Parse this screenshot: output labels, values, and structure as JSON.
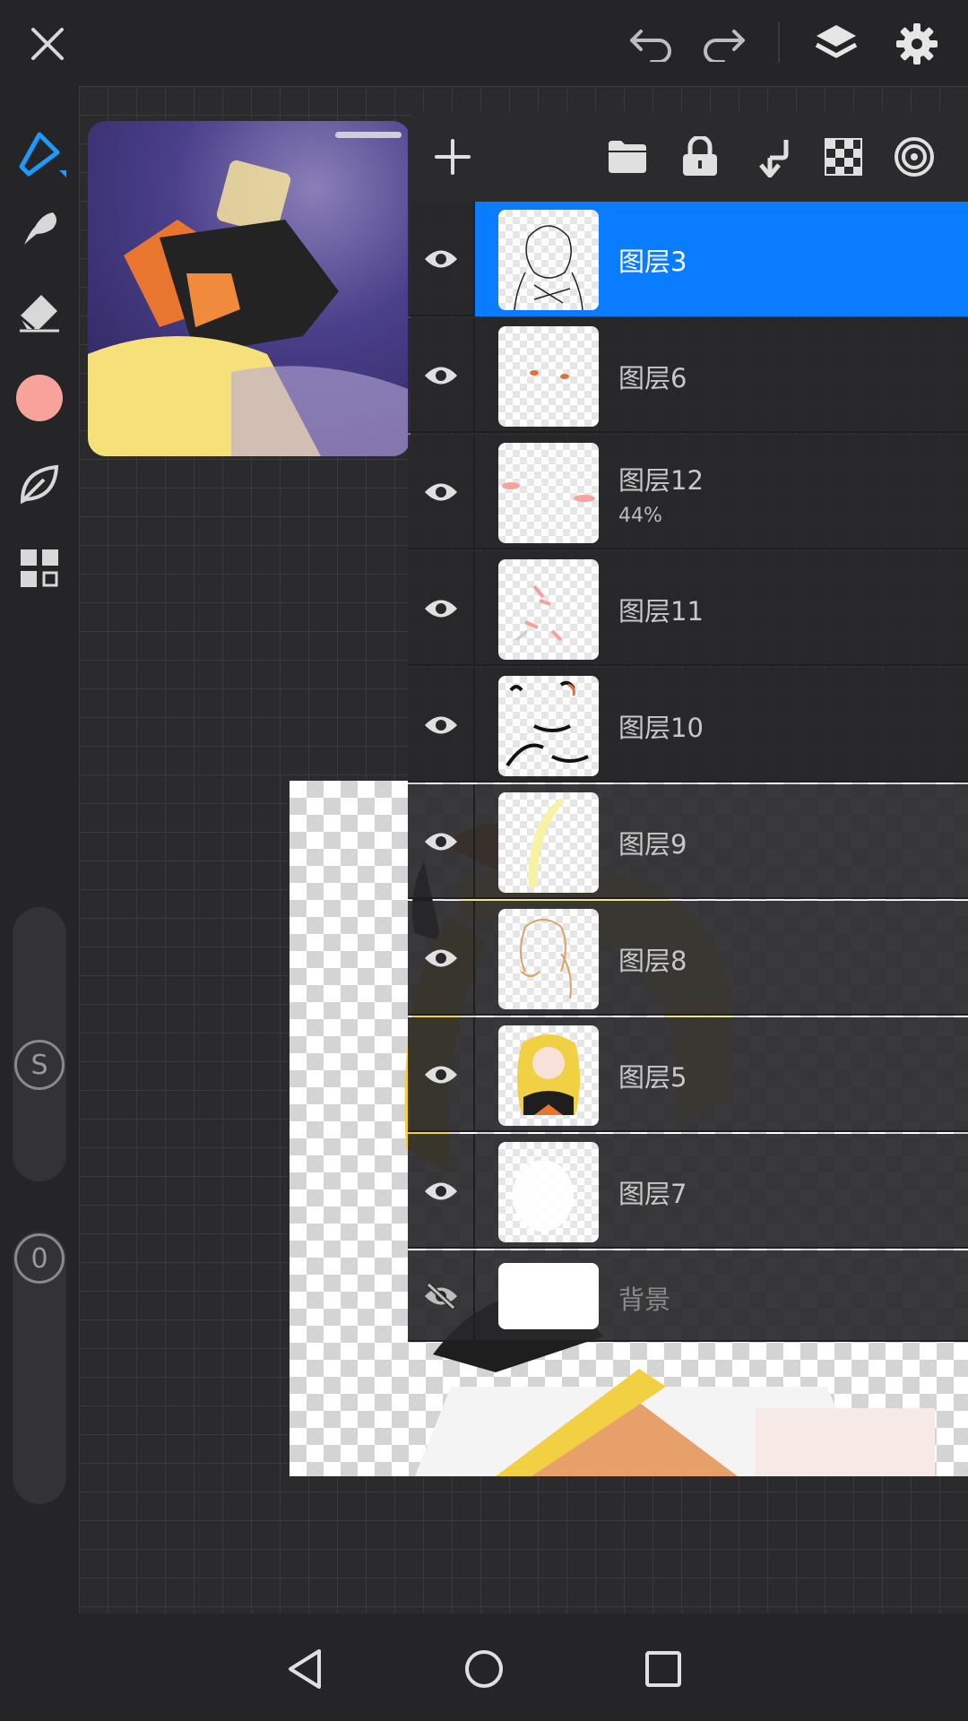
{
  "topbar": {
    "icons": [
      "close-icon",
      "undo-icon",
      "redo-icon",
      "layers-icon",
      "settings-icon"
    ]
  },
  "tools": {
    "icons": [
      "pen-icon",
      "smudge-icon",
      "eraser-icon",
      "color-swatch",
      "leaf-icon",
      "grid-icon"
    ],
    "current_color": "#f7a39c",
    "accent_color": "#1a9bff",
    "size_slider_label": "S",
    "opacity_slider_label": "0"
  },
  "layer_panel": {
    "toolbar_icons": [
      "add-icon",
      "folder-icon",
      "lock-icon",
      "merge-down-icon",
      "checker-icon",
      "target-icon"
    ],
    "selected_color": "#0a7cff",
    "layers": [
      {
        "name": "图层3",
        "visible": true,
        "selected": true
      },
      {
        "name": "图层6",
        "visible": true
      },
      {
        "name": "图层12",
        "visible": true,
        "opacity": "44%"
      },
      {
        "name": "图层11",
        "visible": true
      },
      {
        "name": "图层10",
        "visible": true
      },
      {
        "name": "图层9",
        "visible": true
      },
      {
        "name": "图层8",
        "visible": true
      },
      {
        "name": "图层5",
        "visible": true
      },
      {
        "name": "图层7",
        "visible": true
      },
      {
        "name": "背景",
        "visible": false
      }
    ]
  },
  "navbar": {
    "icons": [
      "back-icon",
      "home-icon",
      "recents-icon"
    ]
  }
}
